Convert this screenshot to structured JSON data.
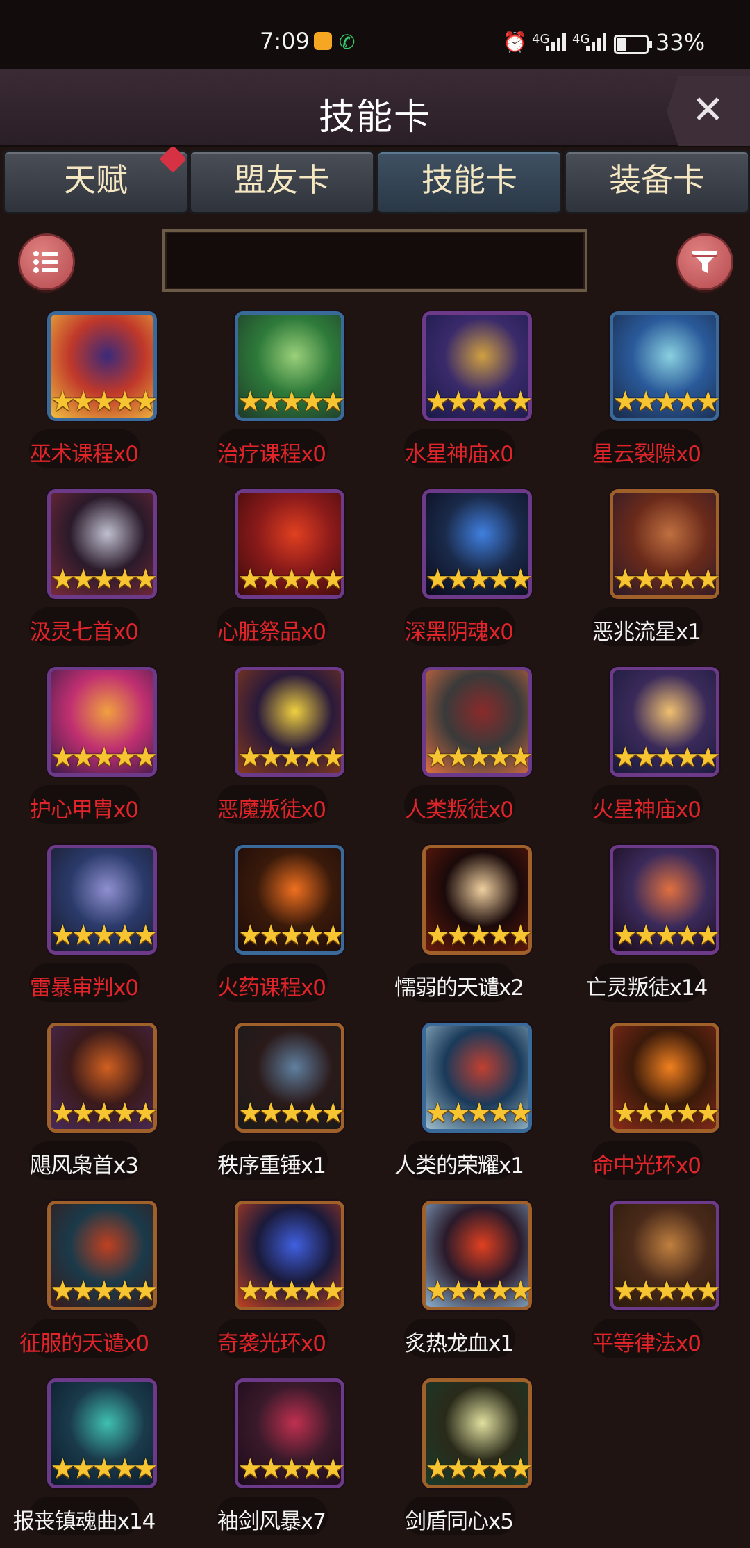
{
  "status_bar": {
    "time": "7:09",
    "network1": "4G",
    "network2": "4G",
    "battery_level": 0.33,
    "battery": "33%"
  },
  "header": {
    "title": "技能卡",
    "close_icon": "close-x-icon"
  },
  "tabs": [
    {
      "label": "天赋",
      "active": false,
      "badge": true
    },
    {
      "label": "盟友卡",
      "active": false,
      "badge": false
    },
    {
      "label": "技能卡",
      "active": true,
      "badge": false
    },
    {
      "label": "装备卡",
      "active": false,
      "badge": false
    }
  ],
  "toolbar": {
    "menu_icon": "list-menu-icon",
    "search_value": "",
    "filter_icon": "filter-funnel-icon"
  },
  "colors": {
    "unowned_text": "#e0242a",
    "owned_text": "#f3f3f3",
    "star": "#f7c531",
    "frame_purple": "#6d3a8a",
    "frame_blue": "#3a6a9a",
    "frame_bronze": "#a0602a"
  },
  "cards": [
    {
      "name": "巫术课程x0",
      "stars": 5,
      "owned": false,
      "frame": "blue"
    },
    {
      "name": "治疗课程x0",
      "stars": 5,
      "owned": false,
      "frame": "blue"
    },
    {
      "name": "水星神庙x0",
      "stars": 5,
      "owned": false,
      "frame": "purple"
    },
    {
      "name": "星云裂隙x0",
      "stars": 5,
      "owned": false,
      "frame": "blue"
    },
    {
      "name": "汲灵七首x0",
      "stars": 5,
      "owned": false,
      "frame": "purple"
    },
    {
      "name": "心脏祭品x0",
      "stars": 5,
      "owned": false,
      "frame": "purple"
    },
    {
      "name": "深黑阴魂x0",
      "stars": 5,
      "owned": false,
      "frame": "purple"
    },
    {
      "name": "恶兆流星x1",
      "stars": 5,
      "owned": true,
      "frame": "bronze"
    },
    {
      "name": "护心甲胄x0",
      "stars": 5,
      "owned": false,
      "frame": "purple"
    },
    {
      "name": "恶魔叛徒x0",
      "stars": 5,
      "owned": false,
      "frame": "purple"
    },
    {
      "name": "人类叛徒x0",
      "stars": 5,
      "owned": false,
      "frame": "purple"
    },
    {
      "name": "火星神庙x0",
      "stars": 5,
      "owned": false,
      "frame": "purple"
    },
    {
      "name": "雷暴审判x0",
      "stars": 5,
      "owned": false,
      "frame": "purple"
    },
    {
      "name": "火药课程x0",
      "stars": 5,
      "owned": false,
      "frame": "blue"
    },
    {
      "name": "懦弱的天谴x2",
      "stars": 5,
      "owned": true,
      "frame": "bronze"
    },
    {
      "name": "亡灵叛徒x14",
      "stars": 5,
      "owned": true,
      "frame": "purple"
    },
    {
      "name": "飓风枭首x3",
      "stars": 5,
      "owned": true,
      "frame": "bronze"
    },
    {
      "name": "秩序重锤x1",
      "stars": 5,
      "owned": true,
      "frame": "bronze"
    },
    {
      "name": "人类的荣耀x1",
      "stars": 5,
      "owned": true,
      "frame": "blue"
    },
    {
      "name": "命中光环x0",
      "stars": 5,
      "owned": false,
      "frame": "bronze"
    },
    {
      "name": "征服的天谴x0",
      "stars": 5,
      "owned": false,
      "frame": "bronze"
    },
    {
      "name": "奇袭光环x0",
      "stars": 5,
      "owned": false,
      "frame": "bronze"
    },
    {
      "name": "炙热龙血x1",
      "stars": 5,
      "owned": true,
      "frame": "bronze"
    },
    {
      "name": "平等律法x0",
      "stars": 5,
      "owned": false,
      "frame": "purple"
    },
    {
      "name": "报丧镇魂曲x14",
      "stars": 5,
      "owned": true,
      "frame": "purple"
    },
    {
      "name": "袖剑风暴x7",
      "stars": 5,
      "owned": true,
      "frame": "purple"
    },
    {
      "name": "剑盾同心x5",
      "stars": 5,
      "owned": true,
      "frame": "bronze"
    }
  ]
}
